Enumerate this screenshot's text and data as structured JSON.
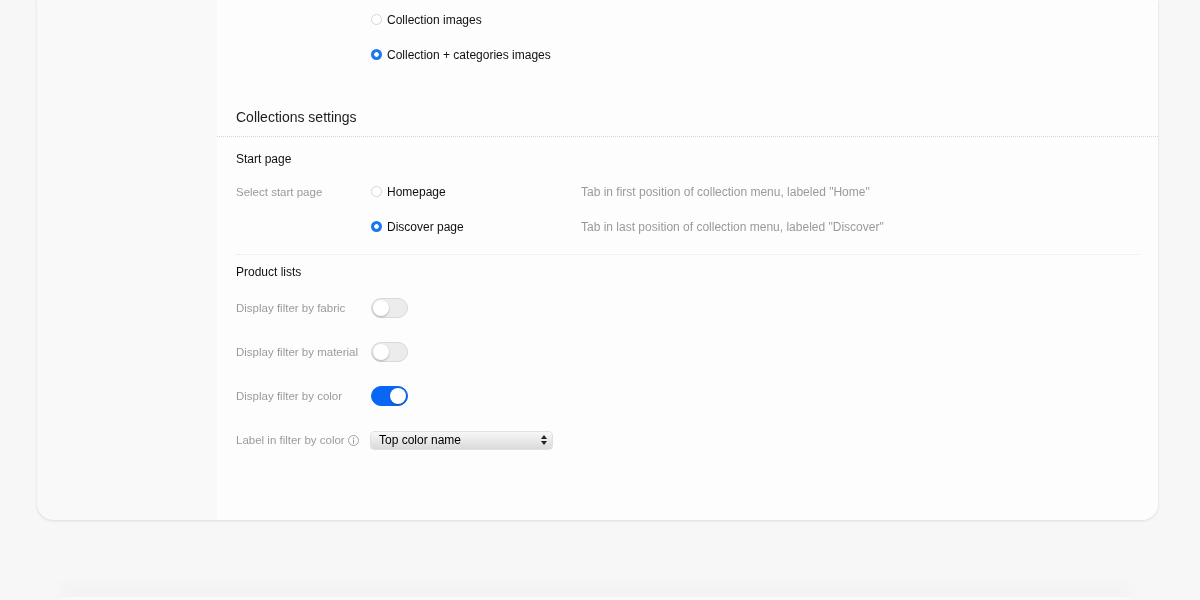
{
  "image_options": [
    {
      "label": "Collection images",
      "selected": false
    },
    {
      "label": "Collection + categories images",
      "selected": true
    }
  ],
  "collections_settings": {
    "title": "Collections settings",
    "start_page": {
      "title": "Start page",
      "label": "Select start page",
      "options": [
        {
          "label": "Homepage",
          "description": "Tab in first position of collection menu, labeled \"Home\"",
          "selected": false
        },
        {
          "label": "Discover page",
          "description": "Tab in last position of collection menu, labeled \"Discover\"",
          "selected": true
        }
      ]
    },
    "product_lists": {
      "title": "Product lists",
      "rows": [
        {
          "kind": "toggle",
          "label": "Display filter by fabric",
          "on": false
        },
        {
          "kind": "toggle",
          "label": "Display filter by material",
          "on": false
        },
        {
          "kind": "toggle",
          "label": "Display filter by color",
          "on": true
        },
        {
          "kind": "select",
          "label": "Label in filter by color",
          "info": true,
          "value": "Top color name"
        }
      ]
    }
  }
}
